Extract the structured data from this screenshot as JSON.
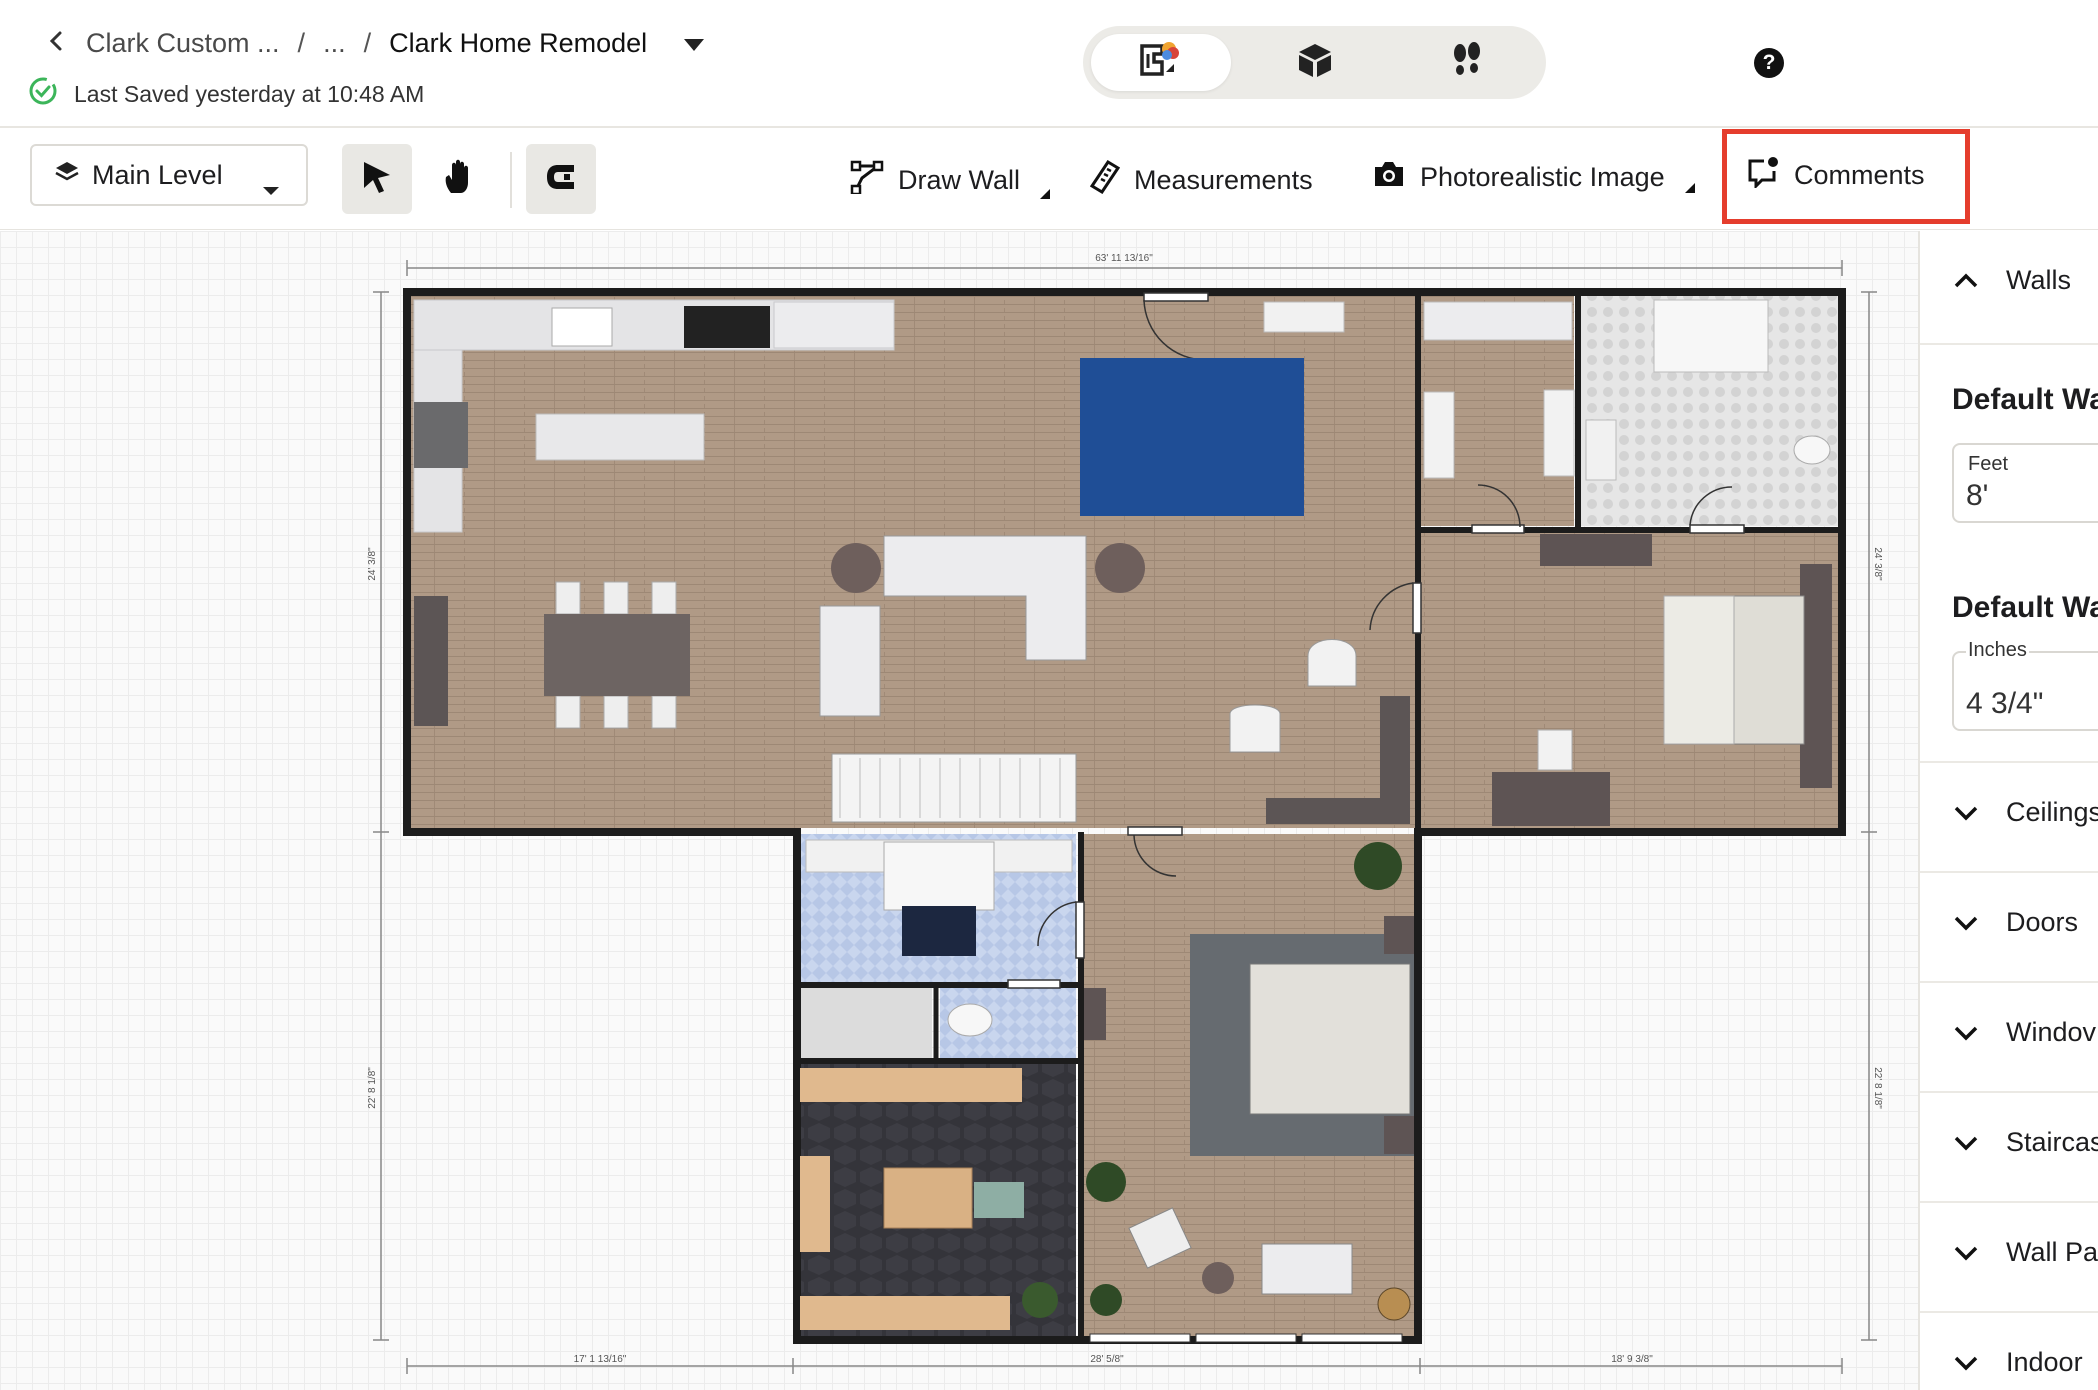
{
  "header": {
    "back_label": "Clark Custom ...",
    "separator_1": "/",
    "ellipsis": "...",
    "separator_2": "/",
    "project_name": "Clark Home Remodel",
    "saved_status": "Last Saved yesterday at 10:48 AM",
    "view_modes": [
      "2d-floorplan-icon",
      "3d-box-icon",
      "walkthrough-footsteps-icon"
    ],
    "active_view": "2d-floorplan-icon",
    "help_label": "?"
  },
  "toolbar": {
    "level_label": "Main Level",
    "tools": [
      "select-arrow-icon",
      "pan-hand-icon",
      "magnet-snap-icon"
    ],
    "draw_wall": "Draw Wall",
    "measurements": "Measurements",
    "photorealistic": "Photorealistic Image",
    "comments": "Comments",
    "highlight_color": "#e53d2d"
  },
  "plan": {
    "dim_top": "63' 11 13/16\"",
    "dim_left_upper": "24' 3/8\"",
    "dim_left_lower": "22' 8 1/8\"",
    "dim_right_upper": "24' 3/8\"",
    "dim_right_lower": "22' 8 1/8\"",
    "dim_bottom_left": "17' 1 13/16\"",
    "dim_bottom_mid": "28' 5/8\"",
    "dim_bottom_right": "18' 9 3/8\""
  },
  "panel": {
    "walls": "Walls",
    "default_height_title": "Default Wa",
    "feet_label": "Feet",
    "feet_value": "8'",
    "default_thickness_title": "Default Wa",
    "inches_label": "Inches",
    "inches_value": "4 3/4\"",
    "sections": [
      "Ceilings",
      "Doors",
      "Windov",
      "Staircas",
      "Wall Par",
      "Indoor"
    ]
  }
}
